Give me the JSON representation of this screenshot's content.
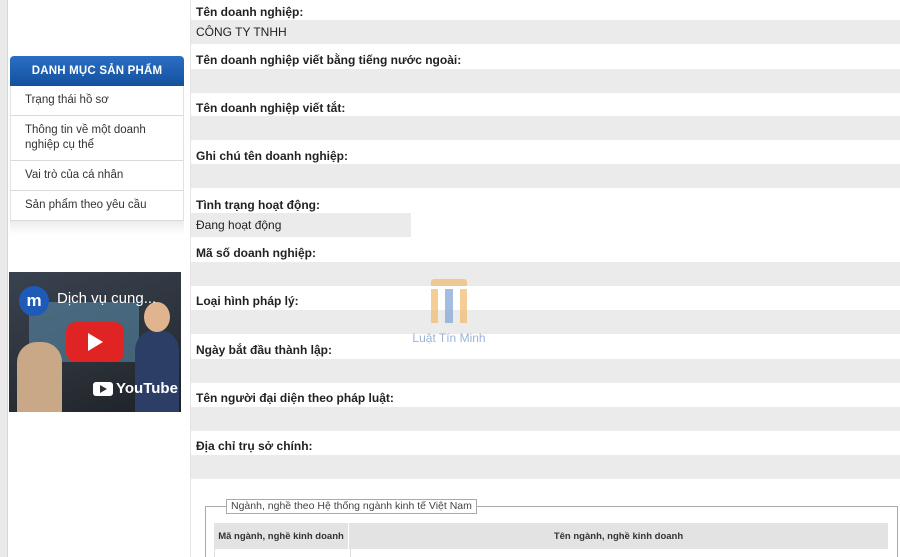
{
  "sidebar": {
    "title": "DANH MỤC SẢN PHẨM",
    "items": [
      {
        "label": "Trạng thái hồ sơ"
      },
      {
        "label": "Thông tin về một doanh nghiệp cụ thể"
      },
      {
        "label": "Vai trò của cá nhân"
      },
      {
        "label": "Sản phẩm theo yêu cầu"
      }
    ]
  },
  "video": {
    "channel_letter": "m",
    "title": "Dịch vụ cung...",
    "platform": "YouTube"
  },
  "fields": [
    {
      "label": "Tên doanh nghiệp:",
      "value": "CÔNG TY TNHH"
    },
    {
      "label": "Tên doanh nghiệp viết bằng tiếng nước ngoài:",
      "value": ""
    },
    {
      "label": "Tên doanh nghiệp viết tắt:",
      "value": ""
    },
    {
      "label": "Ghi chú tên doanh nghiệp:",
      "value": ""
    },
    {
      "label": "Tình trạng hoạt động:",
      "value": "Đang hoạt động"
    },
    {
      "label": "Mã số doanh nghiệp:",
      "value": ""
    },
    {
      "label": "Loại hình pháp lý:",
      "value": ""
    },
    {
      "label": "Ngày bắt đầu thành lập:",
      "value": ""
    },
    {
      "label": "Tên người đại diện theo pháp luật:",
      "value": ""
    },
    {
      "label": "Địa chỉ trụ sở chính:",
      "value": ""
    }
  ],
  "watermark": {
    "text": "Luật Tín Minh"
  },
  "industry_table": {
    "legend": "Ngành, nghề theo Hệ thống ngành kinh tế Việt Nam",
    "columns": [
      "Mã ngành, nghề kinh doanh",
      "Tên ngành, nghề kinh doanh"
    ]
  },
  "colors": {
    "menu_header": "#1a5cb0",
    "field_bg": "#ebebeb",
    "play": "#e02424"
  }
}
